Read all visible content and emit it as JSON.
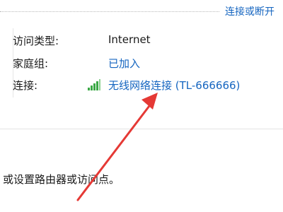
{
  "header": {
    "connect_disconnect_link": "连接或断开"
  },
  "network": {
    "access_type_label": "访问类型:",
    "access_type_value": "Internet",
    "homegroup_label": "家庭组:",
    "homegroup_value": "已加入",
    "connection_label": "连接:",
    "connection_value": "无线网络连接 (TL-666666)",
    "connection_icon": "wifi-signal-icon"
  },
  "footer": {
    "setup_text": "或设置路由器或访问点。"
  },
  "colors": {
    "link": "#1565c0",
    "arrow": "#e53935",
    "signal": "#3aa845"
  }
}
